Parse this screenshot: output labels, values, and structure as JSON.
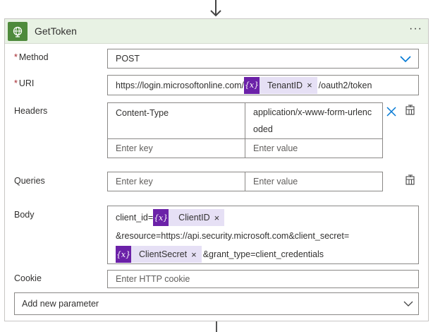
{
  "action": {
    "title": "GetToken",
    "more_label": "···"
  },
  "fields": {
    "method": {
      "label": "Method",
      "required_mark": "*",
      "value": "POST"
    },
    "uri": {
      "label": "URI",
      "required_mark": "*",
      "prefix": "https://login.microsoftonline.com/",
      "token": {
        "icon_text": "{x}",
        "label": "TenantID",
        "remove": "×"
      },
      "suffix": "/oauth2/token"
    },
    "headers": {
      "label": "Headers",
      "rows": [
        {
          "key": "Content-Type",
          "value_line1": "application/x-www-form-urlenc",
          "value_line2": "oded"
        }
      ],
      "key_placeholder": "Enter key",
      "value_placeholder": "Enter value"
    },
    "queries": {
      "label": "Queries",
      "key_placeholder": "Enter key",
      "value_placeholder": "Enter value"
    },
    "body": {
      "label": "Body",
      "line1_prefix": "client_id=",
      "token1": {
        "icon_text": "{x}",
        "label": "ClientID",
        "remove": "×"
      },
      "line2": "&resource=https://api.security.microsoft.com&client_secret=",
      "token2": {
        "icon_text": "{x}",
        "label": "ClientSecret",
        "remove": "×"
      },
      "line3_suffix": "&grant_type=client_credentials"
    },
    "cookie": {
      "label": "Cookie",
      "placeholder": "Enter HTTP cookie"
    }
  },
  "add_parameter": {
    "label": "Add new parameter"
  },
  "icons": {
    "header": "globe-icon",
    "method_dropdown": "chevron-down-icon",
    "header_remove": "close-icon",
    "header_switch": "text-mode-icon",
    "queries_switch": "text-mode-icon",
    "add_param_dropdown": "chevron-down-icon"
  },
  "colors": {
    "header_bg": "#e8f2e4",
    "header_icon_bg": "#4e8a3c",
    "token_bg": "#e6e0f5",
    "token_icon_bg": "#6b21a8",
    "required": "#a4262c",
    "accent": "#0078d4"
  }
}
